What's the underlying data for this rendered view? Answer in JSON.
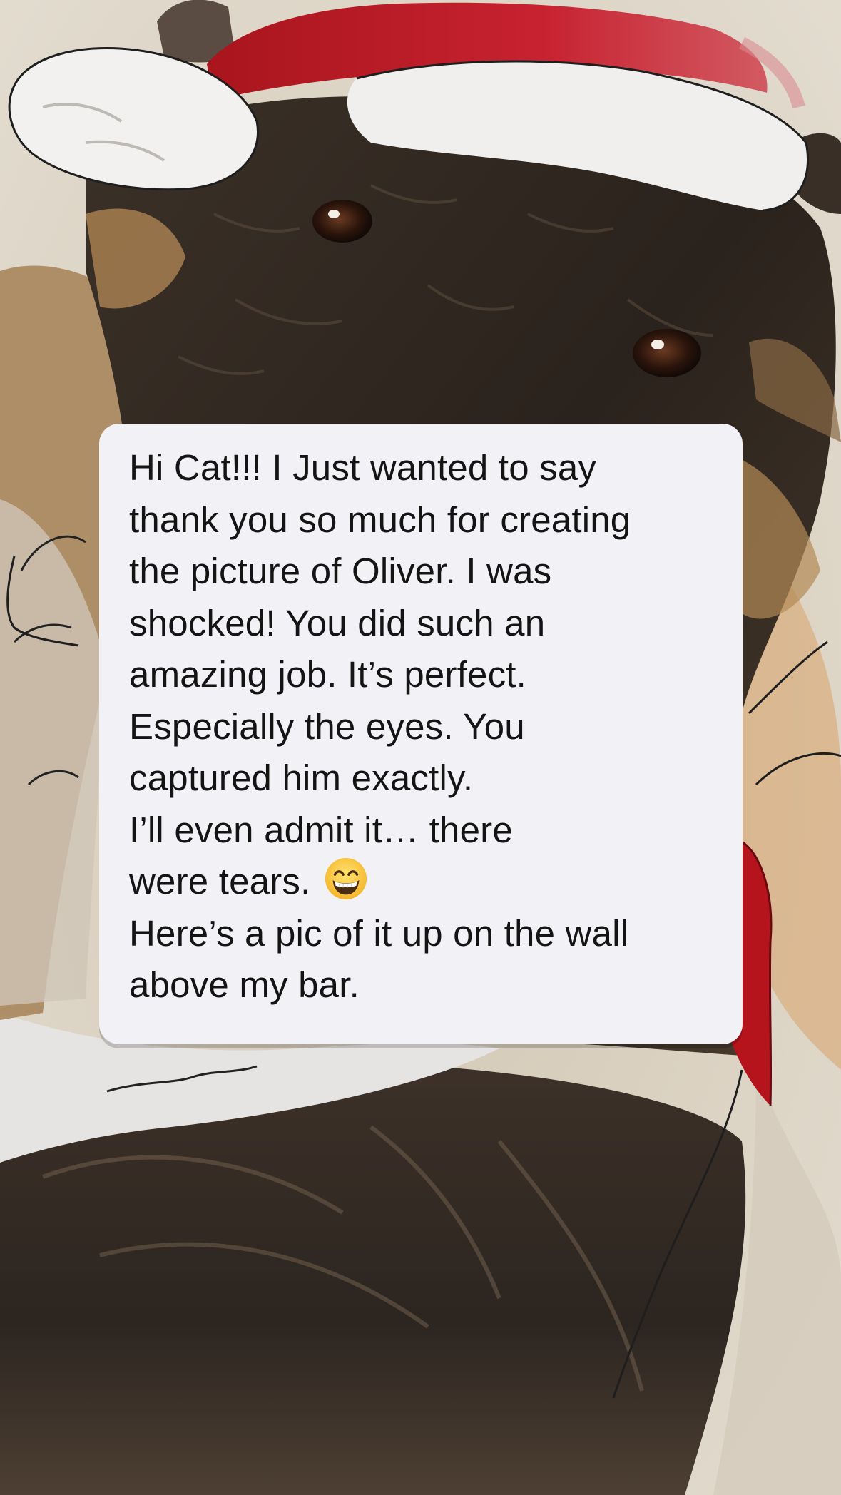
{
  "message": {
    "lines": [
      "Hi Cat!!! I Just wanted to say",
      "thank you so much for creating",
      "the picture of Oliver. I was",
      "shocked! You did such an",
      "amazing job. It’s perfect.",
      "Especially the eyes. You",
      "captured him exactly.",
      "I’ll even admit it… there",
      "were tears. ",
      "Here’s a pic of it up on the wall",
      "above my bar."
    ],
    "emoji": "grinning-face-with-smiling-eyes"
  },
  "background": {
    "description_icon": "dog-painting-with-santa-hat"
  },
  "colors": {
    "bubble": "#f2f2f6",
    "text": "#141414",
    "hat_red": "#c11a24",
    "fur_dark": "#2e2620",
    "fur_tan": "#b48a55"
  }
}
